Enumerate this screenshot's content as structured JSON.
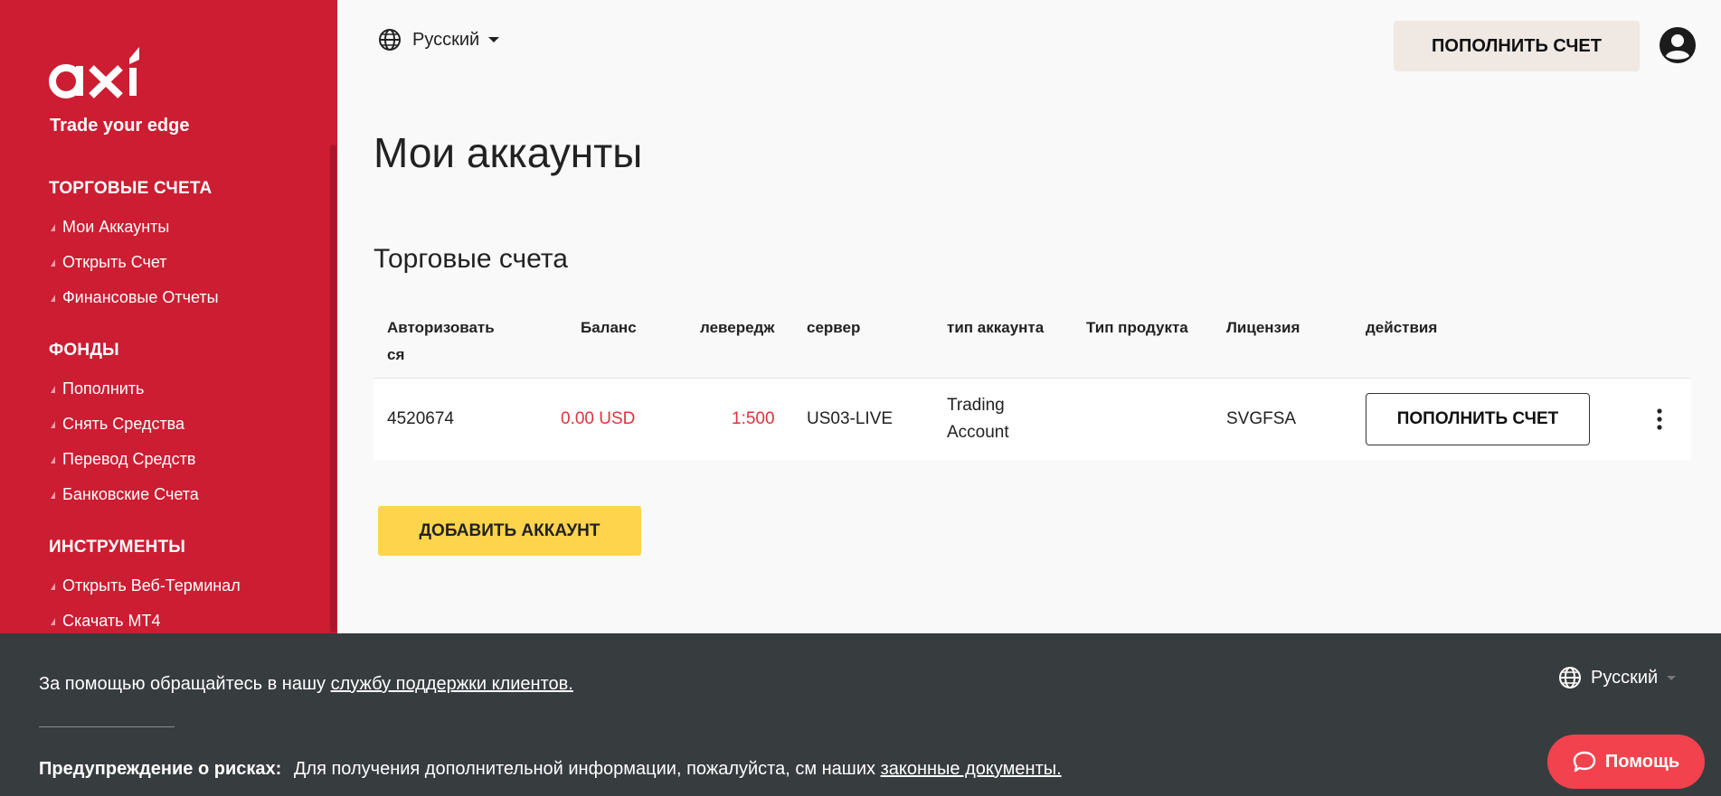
{
  "brand": {
    "logo_text": "axi",
    "tagline": "Trade your edge",
    "primary_color": "#cc1d32",
    "accent_yellow": "#fdd44c",
    "negative_color": "#e0323f"
  },
  "sidebar": {
    "sections": [
      {
        "heading": "ТОРГОВЫЕ СЧЕТА",
        "items": [
          {
            "label": "Мои Аккаунты"
          },
          {
            "label": "Открыть Счет"
          },
          {
            "label": "Финансовые Отчеты"
          }
        ]
      },
      {
        "heading": "ФОНДЫ",
        "items": [
          {
            "label": "Пополнить"
          },
          {
            "label": "Снять Средства"
          },
          {
            "label": "Перевод Средств"
          },
          {
            "label": "Банковские Счета"
          }
        ]
      },
      {
        "heading": "ИНСТРУМЕНТЫ",
        "items": [
          {
            "label": "Открыть Веб-Терминал"
          },
          {
            "label": "Скачать MT4"
          }
        ]
      }
    ]
  },
  "header": {
    "language": "Русский",
    "topup_label": "ПОПОЛНИТЬ СЧЕТ",
    "icons": {
      "language": "globe-icon",
      "avatar": "user-circle-icon"
    }
  },
  "main": {
    "page_title": "Мои аккаунты",
    "section_title": "Торговые счета",
    "table": {
      "columns": [
        "Авторизоваться",
        "Баланс",
        "левередж",
        "сервер",
        "тип аккаунта",
        "Тип продукта",
        "Лицензия",
        "действия"
      ],
      "column_first_line": "Авторизовать",
      "column_second_line": "ся",
      "rows": [
        {
          "login": "4520674",
          "balance": "0.00 USD",
          "leverage": "1:500",
          "server": "US03-LIVE",
          "account_type_line1": "Trading",
          "account_type_line2": "Account",
          "product_type": "",
          "license": "SVGFSA",
          "action_label": "ПОПОЛНИТЬ СЧЕТ"
        }
      ]
    },
    "add_account_label": "ДОБАВИТЬ АККАУНТ"
  },
  "footer": {
    "support_prefix": "За помощью обращайтесь в нашу ",
    "support_link": "службу поддержки клиентов.",
    "risk_label": "Предупреждение о рисках:",
    "risk_text": "Для получения дополнительной информации, пожалуйста, см наших ",
    "risk_link": "законные документы.",
    "language": "Русский",
    "help_label": "Помощь",
    "icons": {
      "language": "globe-icon",
      "help": "chat-bubble-icon"
    }
  }
}
